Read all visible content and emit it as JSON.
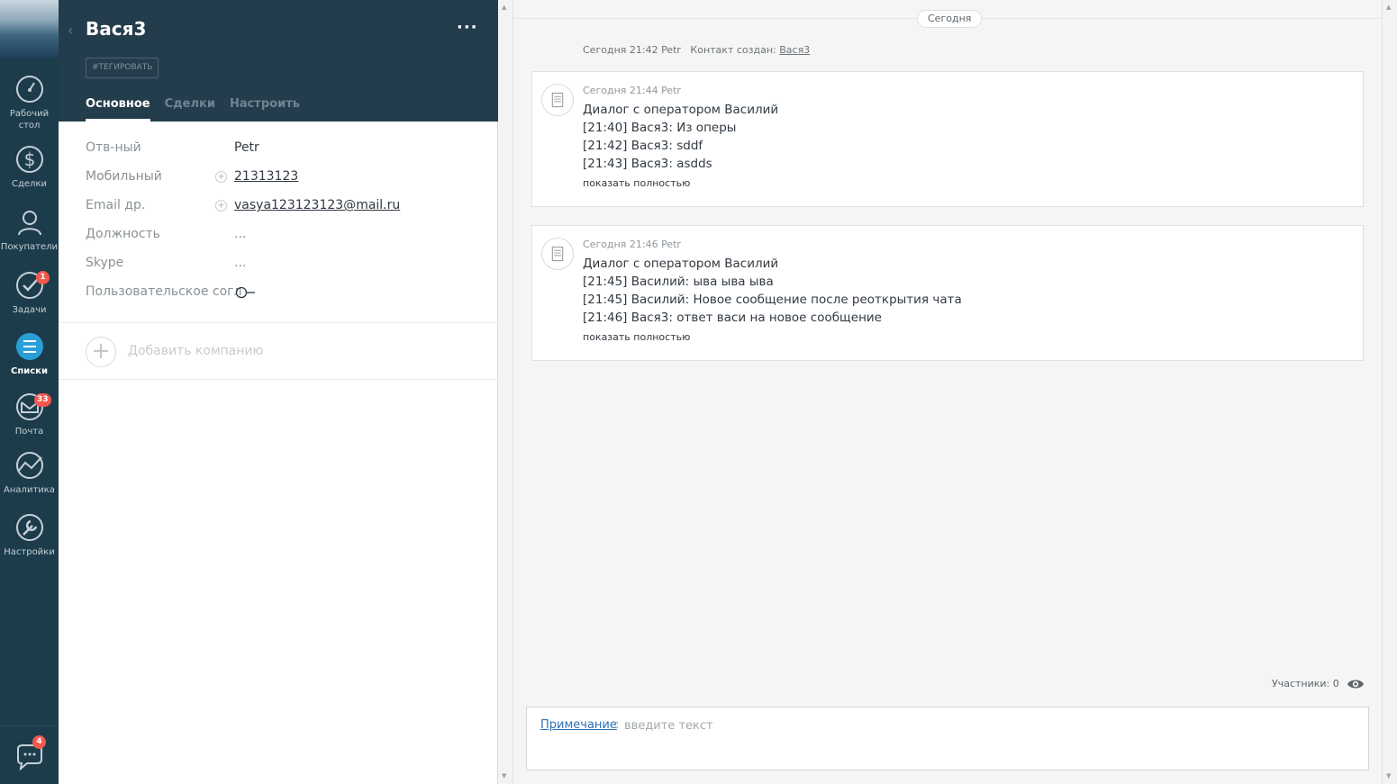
{
  "nav": {
    "items": [
      {
        "label": "Рабочий стол",
        "icon": "dashboard-icon"
      },
      {
        "label": "Сделки",
        "icon": "dollar-icon"
      },
      {
        "label": "Покупатели",
        "icon": "customers-icon"
      },
      {
        "label": "Задачи",
        "icon": "check-icon",
        "badge": "1"
      },
      {
        "label": "Списки",
        "icon": "lists-icon"
      },
      {
        "label": "Почта",
        "icon": "mail-icon",
        "badge": "33"
      },
      {
        "label": "Аналитика",
        "icon": "analytics-icon"
      },
      {
        "label": "Настройки",
        "icon": "wrench-icon"
      }
    ],
    "chat_badge": "4"
  },
  "contact": {
    "name": "Вася3",
    "more": "···",
    "tag_label": "#ТЕГИРОВАТЬ",
    "tabs": [
      "Основное",
      "Сделки",
      "Настроить"
    ],
    "fields": [
      {
        "label": "Отв-ный",
        "value": "Petr"
      },
      {
        "label": "Мобильный",
        "value": "21313123"
      },
      {
        "label": "Email др.",
        "value": "vasya123123123@mail.ru"
      },
      {
        "label": "Должность",
        "value": "..."
      },
      {
        "label": "Skype",
        "value": "..."
      },
      {
        "label": "Пользовательское согл",
        "value": ""
      }
    ],
    "add_company": "Добавить компанию"
  },
  "feed": {
    "date_pill": "Сегодня",
    "event": {
      "meta": "Сегодня 21:42 Petr",
      "text": "Контакт создан:",
      "link": "Вася3"
    },
    "notes": [
      {
        "meta": "Сегодня 21:44 Petr",
        "lines": [
          "Диалог с оператором Василий",
          "[21:40] Вася3: Из оперы",
          "[21:42] Вася3: sddf",
          "[21:43] Вася3: asdds"
        ],
        "more": "показать полностью"
      },
      {
        "meta": "Сегодня 21:46 Petr",
        "lines": [
          "Диалог с оператором Василий",
          "[21:45] Василий: ыва ыва ыва",
          "[21:45] Василий: Новое сообщение после реоткрытия чата",
          "[21:46] Вася3: ответ васи на новое сообщение"
        ],
        "more": "показать полностью"
      }
    ],
    "participants": "Участники: 0"
  },
  "composer": {
    "type_label": "Примечание",
    "colon": ":",
    "placeholder": "введите текст"
  },
  "colors": {
    "nav_bg": "#1c3c4b",
    "header_bg": "#243d4c",
    "badge": "#f2584d",
    "link": "#2d6fb8",
    "active_nav": "#2a9fd6"
  }
}
